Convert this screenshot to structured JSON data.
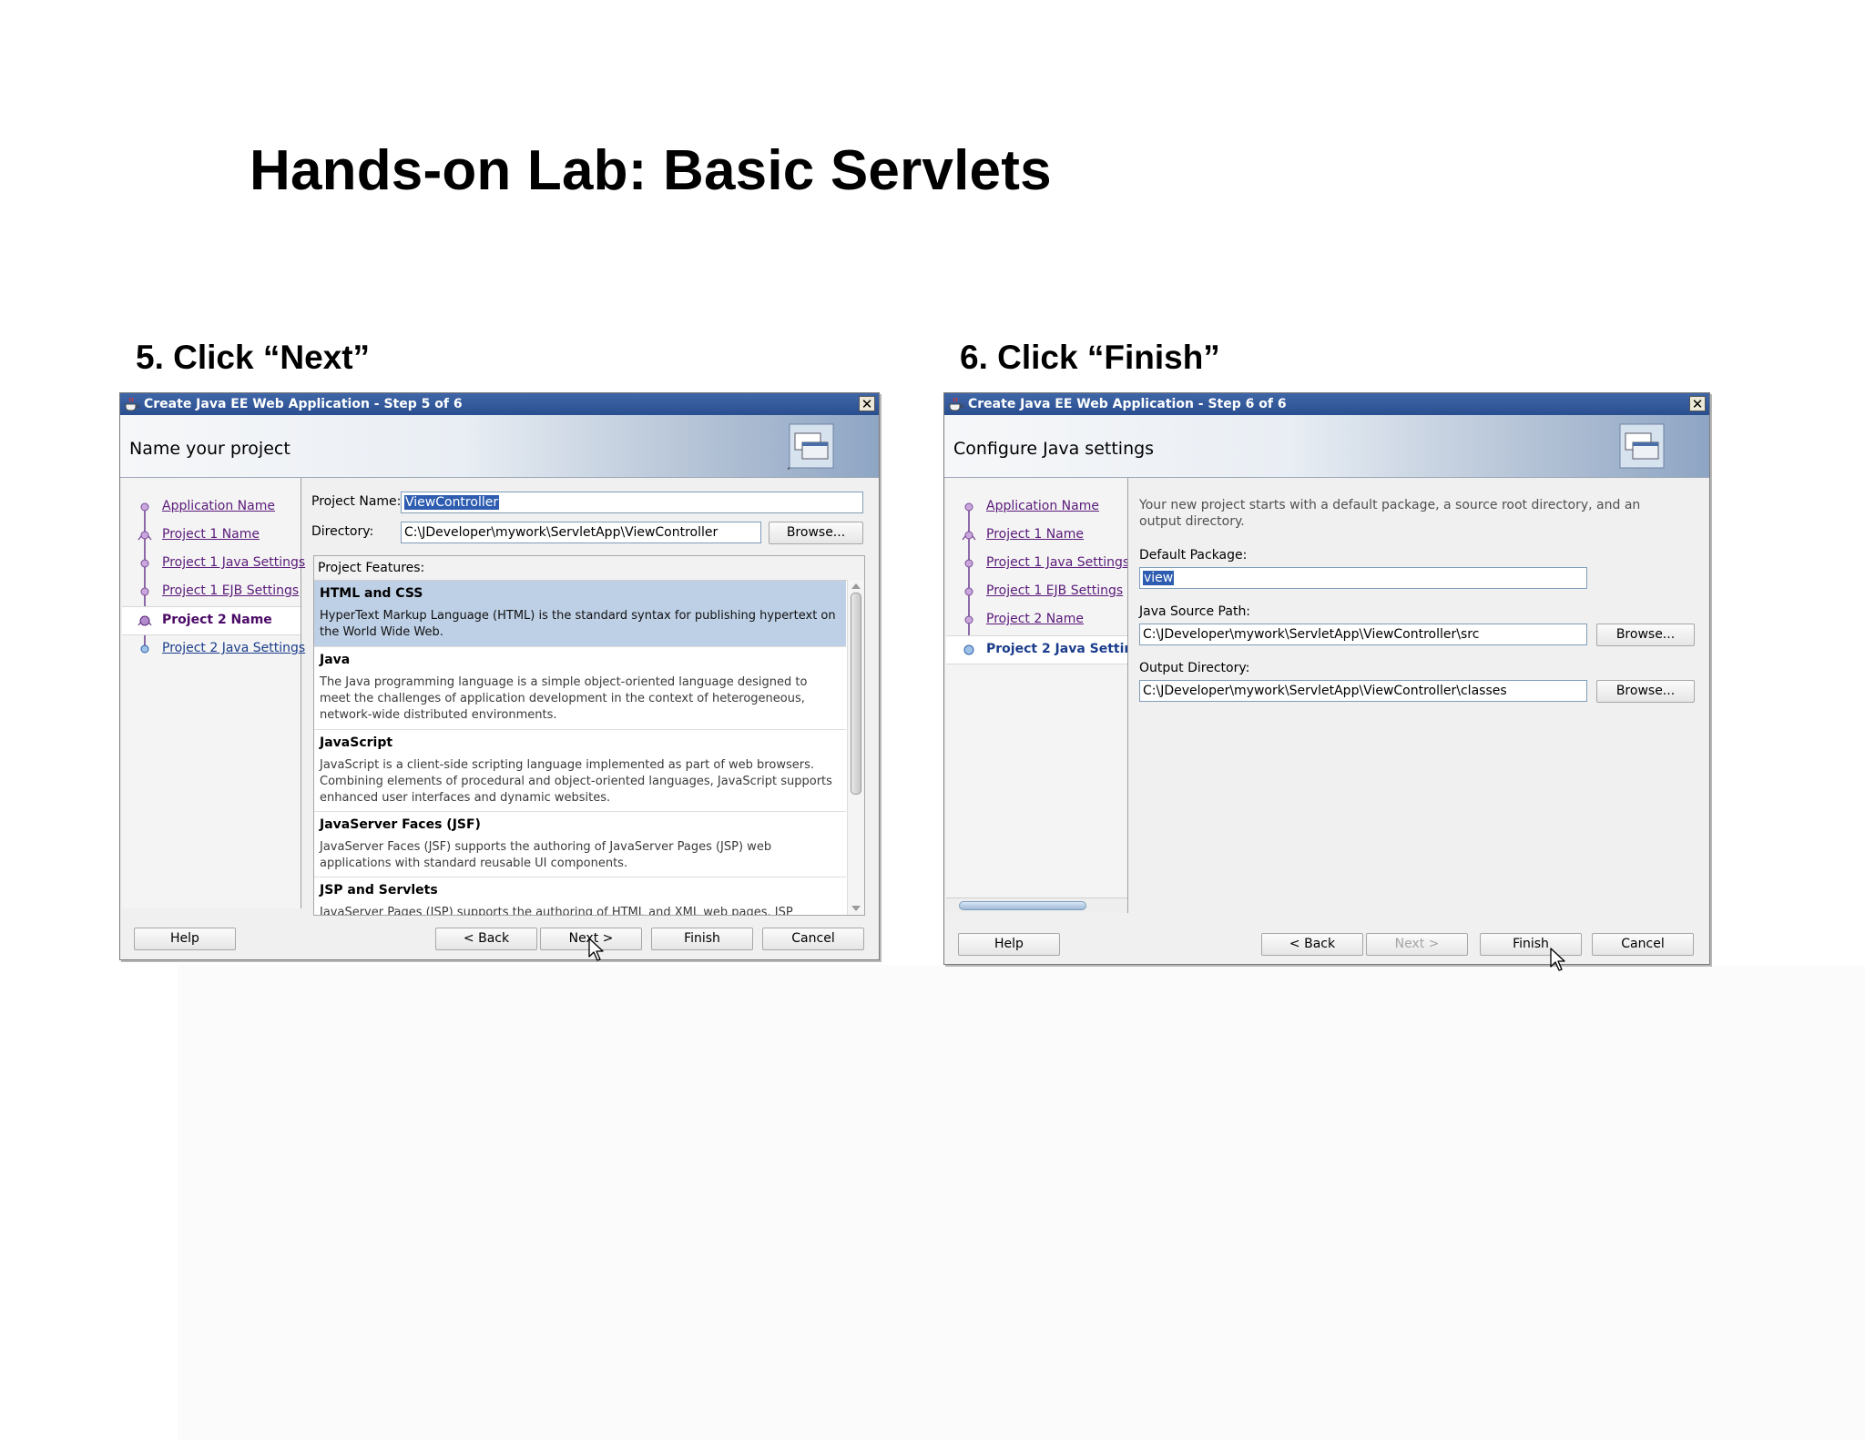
{
  "slide": {
    "title": "Hands-on Lab: Basic Servlets",
    "captions": [
      "5. Click “Next”",
      "6. Click “Finish”"
    ]
  },
  "dialog5": {
    "window_title": "Create Java EE Web Application - Step 5 of 6",
    "header_title": "Name your project",
    "nav_items": [
      {
        "label": "Application Name"
      },
      {
        "label": "Project 1 Name"
      },
      {
        "label": "Project 1 Java Settings"
      },
      {
        "label": "Project 1 EJB Settings"
      },
      {
        "label": "Project 2 Name"
      },
      {
        "label": "Project 2 Java Settings"
      }
    ],
    "current_step": "Project 2 Name",
    "project_name_label": "Project Name:",
    "project_name_value": "ViewController",
    "directory_label": "Directory:",
    "directory_value": "C:\\JDeveloper\\mywork\\ServletApp\\ViewController",
    "browse_label": "Browse...",
    "features_label": "Project Features:",
    "features": [
      {
        "name": "HTML and CSS",
        "description": "HyperText Markup Language (HTML) is the standard syntax for publishing hypertext on the World Wide Web."
      },
      {
        "name": "Java",
        "description": "The Java programming language is a simple object-oriented language designed to meet the challenges of application development in the context of heterogeneous, network-wide distributed environments."
      },
      {
        "name": "JavaScript",
        "description": "JavaScript is a client-side scripting language implemented as part of web browsers. Combining elements of procedural and object-oriented languages, JavaScript supports enhanced user interfaces and dynamic websites."
      },
      {
        "name": "JavaServer Faces (JSF)",
        "description": "JavaServer Faces (JSF) supports the authoring of JavaServer Pages (JSP) web applications with standard reusable UI components."
      },
      {
        "name": "JSP and Servlets",
        "description": "JavaServer Pages (JSP) supports the authoring of HTML and XML web pages. JSP"
      }
    ],
    "buttons": {
      "help": "Help",
      "back": "< Back",
      "next": "Next >",
      "finish": "Finish",
      "cancel": "Cancel"
    }
  },
  "dialog6": {
    "window_title": "Create Java EE Web Application - Step 6 of 6",
    "header_title": "Configure Java settings",
    "nav_items": [
      {
        "label": "Application Name"
      },
      {
        "label": "Project 1 Name"
      },
      {
        "label": "Project 1 Java Settings"
      },
      {
        "label": "Project 1 EJB Settings"
      },
      {
        "label": "Project 2 Name"
      },
      {
        "label": "Project 2 Java Settir"
      }
    ],
    "current_step": "Project 2 Java Settir",
    "intro": "Your new project starts with a default package, a source root directory, and an output directory.",
    "default_package_label": "Default Package:",
    "default_package_value": "view",
    "source_path_label": "Java Source Path:",
    "source_path_value": "C:\\JDeveloper\\mywork\\ServletApp\\ViewController\\src",
    "output_dir_label": "Output Directory:",
    "output_dir_value": "C:\\JDeveloper\\mywork\\ServletApp\\ViewController\\classes",
    "browse_label": "Browse...",
    "buttons": {
      "help": "Help",
      "back": "< Back",
      "next": "Next >",
      "finish": "Finish",
      "cancel": "Cancel"
    },
    "next_disabled": true
  },
  "icons": [
    "java-cup-icon",
    "close-icon",
    "wizard-header-icon",
    "nav-step-icon",
    "mouse-cursor-icon"
  ]
}
